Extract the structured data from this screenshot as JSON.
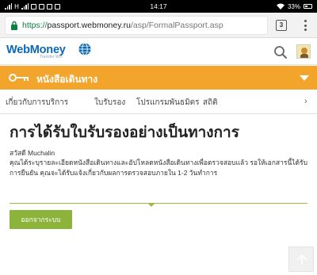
{
  "status_bar": {
    "time": "14:17",
    "battery": "33%",
    "network_label": "H"
  },
  "browser": {
    "url_scheme": "https://",
    "url_host": "passport.webmoney.ru",
    "url_path": "/asp/FormalPassport.asp",
    "tab_count": "3"
  },
  "site": {
    "logo_text": "WebMoney",
    "logo_subtext": "Transfer Wm",
    "section_title": "หนังสือเดินทาง",
    "tabs": [
      {
        "label": "เกี่ยวกับการบริการ"
      },
      {
        "label": "ใบรับรอง"
      },
      {
        "label": "โปรแกรมพันธมิตร"
      },
      {
        "label": "สถิติ"
      }
    ],
    "tabs_more": "›"
  },
  "main": {
    "title": "การได้รับใบรับรองอย่างเป็นทางการ",
    "greeting": "สวัสดี Muchalin",
    "message": "คุณได้ระบุรายละเอียดหนังสือเดินทางและอัปโหลดหนังสือเดินทางเพื่อตรวจสอบแล้ว รอให้เอกสารนี้ได้รับการยืนยัน คุณจะได้รับแจ้งเกี่ยวกับผลการตรวจสอบภายใน 1-2 วันทำการ",
    "logout_label": "ออกจากระบบ"
  },
  "colors": {
    "brand_blue": "#0a68b4",
    "section_orange": "#f3a42a",
    "accent_green": "#8cb33a"
  }
}
